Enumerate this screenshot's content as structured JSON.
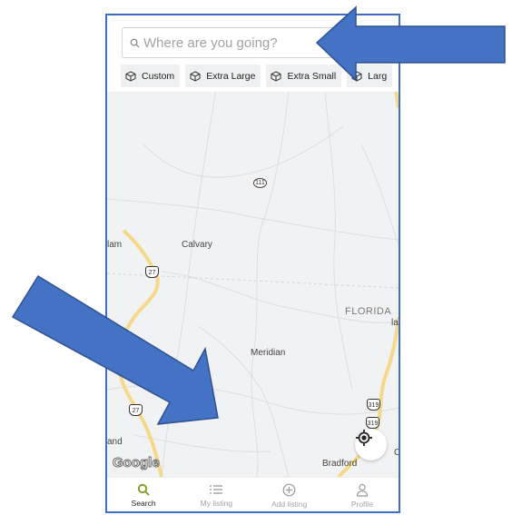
{
  "search": {
    "placeholder": "Where are you going?"
  },
  "chips": [
    {
      "label": "Custom"
    },
    {
      "label": "Extra Large"
    },
    {
      "label": "Extra Small"
    },
    {
      "label": "Larg"
    }
  ],
  "map": {
    "places": {
      "calvary": "Calvary",
      "meridian": "Meridian",
      "florida": "FLORIDA",
      "bradford": "Bradford",
      "lam": "lam",
      "inson": "inson",
      "and": "and",
      "la": "la",
      "c": "C"
    },
    "shields": {
      "r111": "111",
      "r27a": "27",
      "r27b": "27",
      "r319a": "319",
      "r319b": "319"
    },
    "attribution": "Google"
  },
  "tabs": [
    {
      "label": "Search",
      "icon": "search-icon",
      "active": true
    },
    {
      "label": "My listing",
      "icon": "list-icon",
      "active": false
    },
    {
      "label": "Add listing",
      "icon": "add-circle-icon",
      "active": false
    },
    {
      "label": "Profile",
      "icon": "user-icon",
      "active": false
    }
  ],
  "colors": {
    "accent": "#7a9a1a",
    "frame": "#3d6fc4",
    "arrow": "#4472c4",
    "highway": "#f5d98b"
  }
}
